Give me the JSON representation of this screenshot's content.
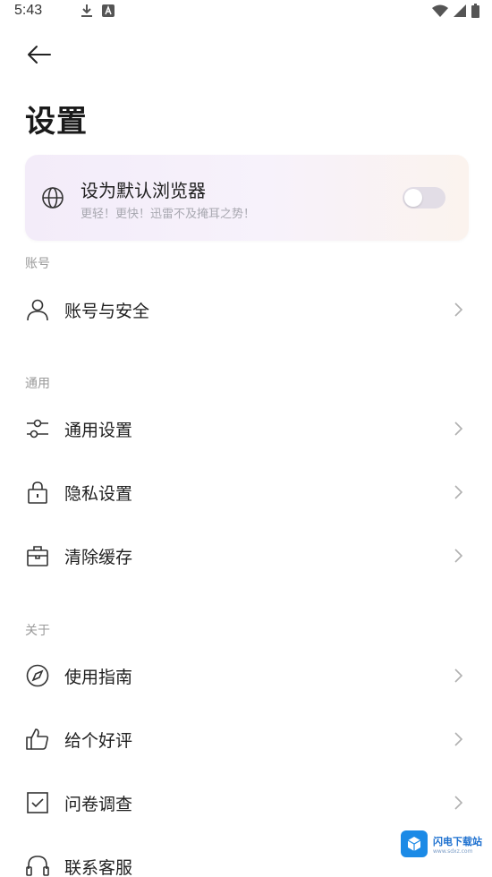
{
  "status_bar": {
    "time": "5:43",
    "left_icons": [
      "download-icon",
      "app-notification-icon"
    ],
    "right_icons": [
      "wifi-icon",
      "signal-icon",
      "battery-icon"
    ]
  },
  "header": {
    "back_icon": "back-arrow-icon",
    "title": "设置"
  },
  "default_browser_card": {
    "icon": "globe-icon",
    "title": "设为默认浏览器",
    "subtitle": "更轻！更快！迅雷不及掩耳之势！",
    "toggle_on": false
  },
  "sections": [
    {
      "header": "账号",
      "items": [
        {
          "label": "账号与安全",
          "icon": "user-icon"
        }
      ]
    },
    {
      "header": "通用",
      "items": [
        {
          "label": "通用设置",
          "icon": "sliders-icon"
        },
        {
          "label": "隐私设置",
          "icon": "lock-icon"
        },
        {
          "label": "清除缓存",
          "icon": "cache-box-icon"
        }
      ]
    },
    {
      "header": "关于",
      "items": [
        {
          "label": "使用指南",
          "icon": "compass-icon"
        },
        {
          "label": "给个好评",
          "icon": "thumbs-up-icon"
        },
        {
          "label": "问卷调查",
          "icon": "checkbox-icon"
        },
        {
          "label": "联系客服",
          "icon": "headset-icon"
        }
      ]
    }
  ],
  "watermark": {
    "name": "闪电下载站",
    "url": "www.sdxz.com",
    "brand_color": "#1b8ae6"
  },
  "colors": {
    "card_gradient_start": "#f3ecf9",
    "card_gradient_end": "#fbf3ee",
    "section_header": "#9a9a9a",
    "chevron": "#b0b0b0"
  }
}
